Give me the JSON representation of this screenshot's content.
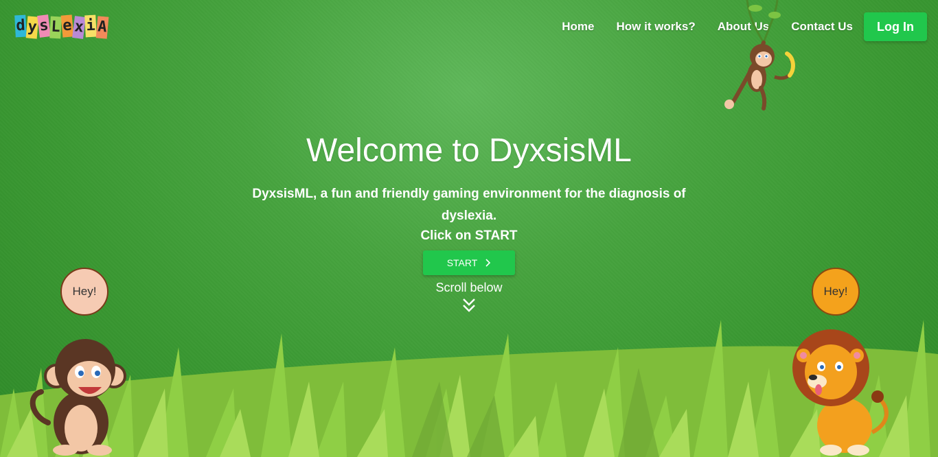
{
  "logo": {
    "letters": [
      "d",
      "y",
      "s",
      "L",
      "e",
      "x",
      "i",
      "A"
    ],
    "colors": [
      "#2fb8d8",
      "#f6d84a",
      "#f08bb5",
      "#9ad35a",
      "#f29a3a",
      "#b98ad6",
      "#f7e067",
      "#f28a5a"
    ]
  },
  "nav": {
    "home": "Home",
    "how": "How it works?",
    "about": "About Us",
    "contact": "Contact Us",
    "login": "Log In"
  },
  "hero": {
    "title": "Welcome to DyxsisML",
    "subtitle": "DyxsisML, a fun and friendly gaming environment for the diagnosis of dyslexia.",
    "click_prefix": "Click on ",
    "click_strong": "START",
    "start_label": "START",
    "scroll_label": "Scroll below"
  },
  "bubbles": {
    "left": "Hey!",
    "right": "Hey!"
  },
  "icons": [
    "chevron-right-icon",
    "double-chevron-down-icon"
  ],
  "colors": {
    "accent": "#21c74c",
    "background": "#47a43f"
  }
}
